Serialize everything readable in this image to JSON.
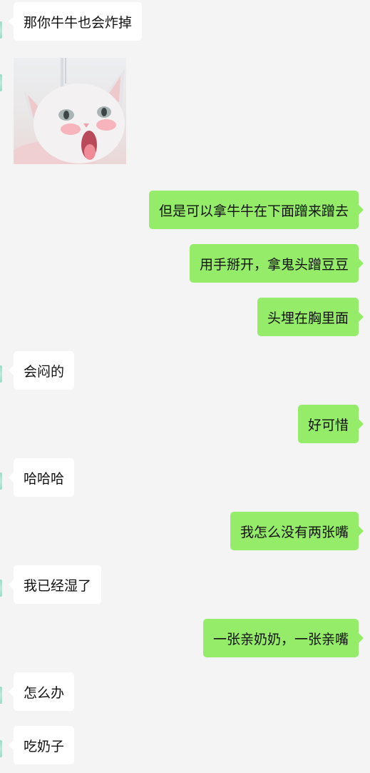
{
  "messages": [
    {
      "side": "left",
      "text": "那你牛牛也会炸掉"
    },
    {
      "side": "left",
      "type": "sticker",
      "icon": "cat-sticker-icon"
    },
    {
      "side": "right",
      "text": "但是可以拿牛牛在下面蹭来蹭去"
    },
    {
      "side": "right",
      "text": "用手掰开，拿鬼头蹭豆豆"
    },
    {
      "side": "right",
      "text": "头埋在胸里面"
    },
    {
      "side": "left",
      "text": "会闷的"
    },
    {
      "side": "right",
      "text": "好可惜"
    },
    {
      "side": "left",
      "text": "哈哈哈"
    },
    {
      "side": "right",
      "text": "我怎么没有两张嘴"
    },
    {
      "side": "left",
      "text": "我已经湿了"
    },
    {
      "side": "right",
      "text": "一张亲奶奶，一张亲嘴"
    },
    {
      "side": "left",
      "text": "怎么办"
    },
    {
      "side": "left",
      "text": "吃奶子"
    }
  ],
  "colors": {
    "background": "#f4f4f4",
    "incoming_bubble": "#ffffff",
    "outgoing_bubble": "#95ec69",
    "text": "#111111"
  }
}
